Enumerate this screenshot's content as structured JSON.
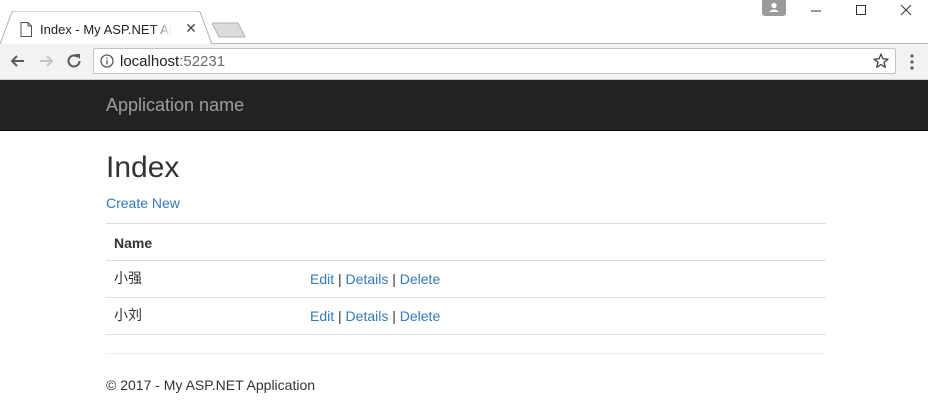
{
  "browser": {
    "tab": {
      "title": "Index - My ASP.NET Application",
      "icon": "page-icon"
    },
    "address": {
      "host": "localhost",
      "port": ":52231"
    },
    "window_controls": {
      "minimize": "—",
      "maximize": "☐",
      "close": "✕"
    }
  },
  "navbar": {
    "brand": "Application name"
  },
  "main": {
    "title": "Index",
    "create_link": "Create New",
    "table": {
      "headers": [
        "Name"
      ],
      "rows": [
        {
          "name": "小强",
          "edit": "Edit",
          "details": "Details",
          "delete": "Delete"
        },
        {
          "name": "小刘",
          "edit": "Edit",
          "details": "Details",
          "delete": "Delete"
        }
      ],
      "separator": " | "
    }
  },
  "footer": {
    "text": "© 2017 - My ASP.NET Application"
  },
  "colors": {
    "navbar_bg": "#222222",
    "brand": "#9d9d9d",
    "link": "#337ab7",
    "text": "#333333"
  }
}
